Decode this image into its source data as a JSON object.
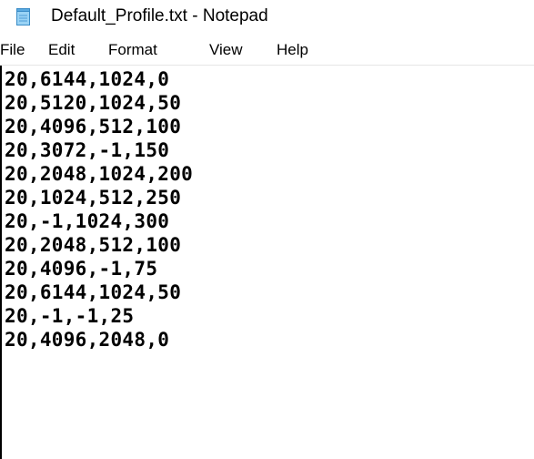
{
  "window": {
    "title": "Default_Profile.txt - Notepad",
    "icon": "notepad-icon"
  },
  "menu": {
    "file": "File",
    "edit": "Edit",
    "format": "Format",
    "view": "View",
    "help": "Help"
  },
  "editor": {
    "lines": [
      "20,6144,1024,0",
      "20,5120,1024,50",
      "20,4096,512,100",
      "20,3072,-1,150",
      "20,2048,1024,200",
      "20,1024,512,250",
      "20,-1,1024,300",
      "20,2048,512,100",
      "20,4096,-1,75",
      "20,6144,1024,50",
      "20,-1,-1,25",
      "20,4096,2048,0"
    ]
  }
}
